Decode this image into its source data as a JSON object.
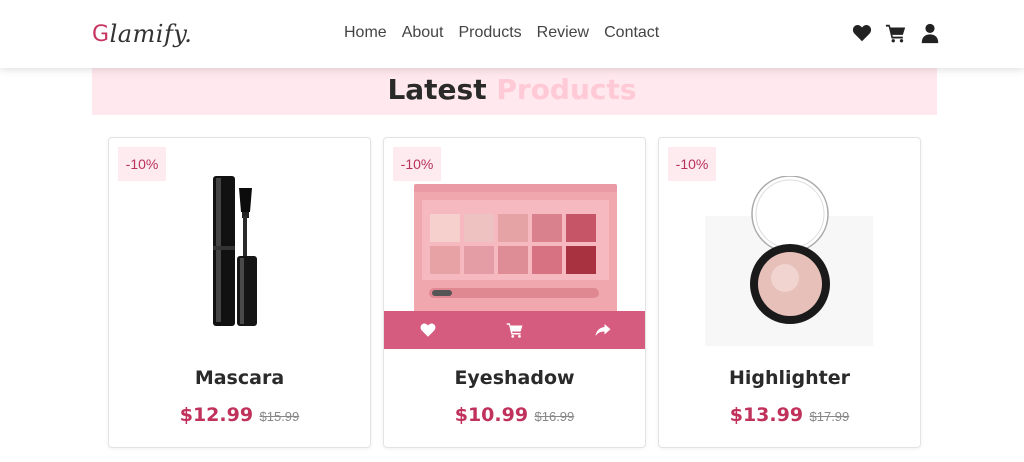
{
  "header": {
    "logo_initial": "G",
    "logo_rest": "lamify.",
    "nav": [
      "Home",
      "About",
      "Products",
      "Review",
      "Contact"
    ],
    "icons": [
      "heart-icon",
      "cart-icon",
      "user-icon"
    ]
  },
  "section": {
    "title_main": "Latest",
    "title_accent": "Products"
  },
  "products": [
    {
      "badge": "-10%",
      "name": "Mascara",
      "price": "$12.99",
      "old_price": "$15.99"
    },
    {
      "badge": "-10%",
      "name": "Eyeshadow",
      "price": "$10.99",
      "old_price": "$16.99"
    },
    {
      "badge": "-10%",
      "name": "Highlighter",
      "price": "$13.99",
      "old_price": "$17.99"
    }
  ],
  "colors": {
    "accent": "#c0315b",
    "action_bar": "#d65c7f",
    "banner": "#ffe8ee",
    "heading_accent": "#ffc9d6"
  }
}
